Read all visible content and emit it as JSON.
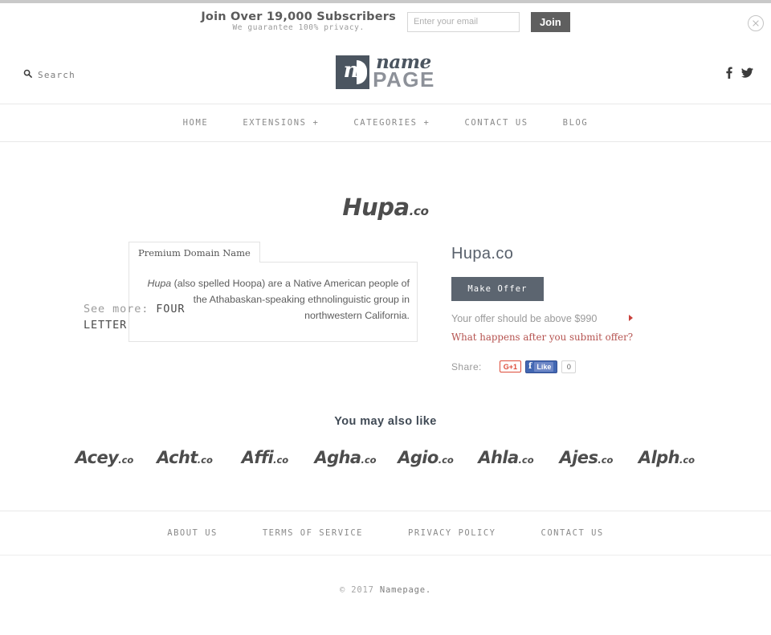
{
  "subscribe": {
    "title": "Join Over 19,000 Subscribers",
    "subtitle": "We guarantee 100% privacy.",
    "email_placeholder": "Enter your email",
    "email_value": "",
    "join_label": "Join",
    "close_icon": "close-circle-icon"
  },
  "header": {
    "search_label": "Search",
    "search_icon": "search-icon",
    "logo": {
      "mark": "n",
      "name": "name",
      "page": "PAGE"
    },
    "social": [
      {
        "icon": "facebook-icon",
        "glyph": "f"
      },
      {
        "icon": "twitter-icon",
        "glyph": "t"
      }
    ]
  },
  "nav": {
    "items": [
      {
        "label": "HOME"
      },
      {
        "label": "EXTENSIONS +"
      },
      {
        "label": "CATEGORIES +"
      },
      {
        "label": "CONTACT US"
      },
      {
        "label": "BLOG"
      }
    ]
  },
  "see_more": {
    "prefix": "See more:",
    "category": "FOUR LETTER"
  },
  "domain": {
    "logo_name": "Hupa",
    "logo_tld": ".co",
    "full_name": "Hupa.co"
  },
  "card": {
    "tab_label": "Premium Domain Name",
    "desc_em": "Hupa",
    "desc_rest": " (also spelled Hoopa) are a Native American people of the Athabaskan-speaking ethnolinguistic group in northwestern California."
  },
  "offer": {
    "make_offer_label": "Make Offer",
    "note": "Your offer should be above $990",
    "link_label": "What happens after you submit offer?",
    "arrow_color": "#c9413c",
    "button_color": "#5c6570"
  },
  "share": {
    "label": "Share:",
    "gplus_label": "G+1",
    "fb_f": "f",
    "fb_like_label": "Like",
    "fb_count": "0"
  },
  "also_like": {
    "title": "You may also like",
    "items": [
      {
        "name": "Acey",
        "tld": ".co"
      },
      {
        "name": "Acht",
        "tld": ".co"
      },
      {
        "name": "Affi",
        "tld": ".co"
      },
      {
        "name": "Agha",
        "tld": ".co"
      },
      {
        "name": "Agio",
        "tld": ".co"
      },
      {
        "name": "Ahla",
        "tld": ".co"
      },
      {
        "name": "Ajes",
        "tld": ".co"
      },
      {
        "name": "Alph",
        "tld": ".co"
      }
    ]
  },
  "footer": {
    "links": [
      {
        "label": "ABOUT US"
      },
      {
        "label": "TERMS OF SERVICE"
      },
      {
        "label": "PRIVACY POLICY"
      },
      {
        "label": "CONTACT US"
      }
    ],
    "copyright_prefix": "© 2017",
    "copyright_brand": "Namepage."
  }
}
